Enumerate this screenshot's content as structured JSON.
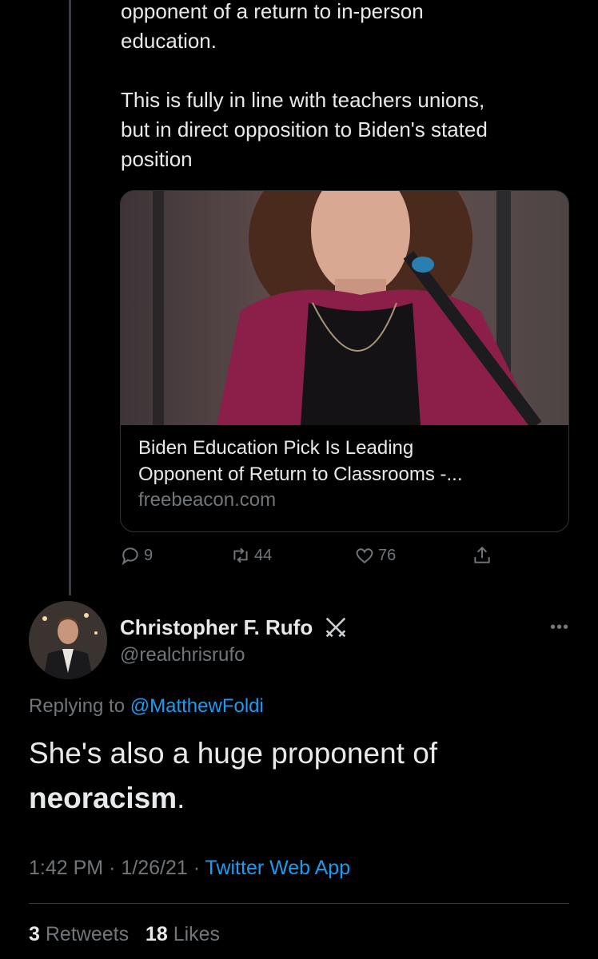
{
  "parent_tweet": {
    "text_line1": "opponent of a return to in-person\neducation.",
    "text_line2": "This is fully in line with teachers unions,\nbut in direct opposition to Biden's stated\nposition",
    "card": {
      "title": "Biden Education Pick Is Leading\nOpponent of Return to Classrooms -...",
      "domain": "freebeacon.com"
    },
    "actions": {
      "replies": "9",
      "retweets": "44",
      "likes": "76"
    }
  },
  "reply_tweet": {
    "name": "Christopher F. Rufo",
    "handle": "@realchrisrufo",
    "replying_prefix": "Replying to",
    "replying_to": "@MatthewFoldi",
    "text_plain": "She's also a huge proponent of",
    "text_bold": "neoracism",
    "text_end": ".",
    "time": "1:42 PM",
    "date": "1/26/21",
    "separator": "·",
    "source": "Twitter Web App",
    "retweets_count": "3",
    "retweets_label": "Retweets",
    "likes_count": "18",
    "likes_label": "Likes"
  },
  "icons": [
    "reply-icon",
    "retweet-icon",
    "like-icon",
    "share-icon",
    "swords-icon",
    "more-icon"
  ],
  "colors": {
    "background": "#000000",
    "text": "#e7e9ea",
    "muted": "#71767b",
    "link": "#1d9bf0"
  }
}
